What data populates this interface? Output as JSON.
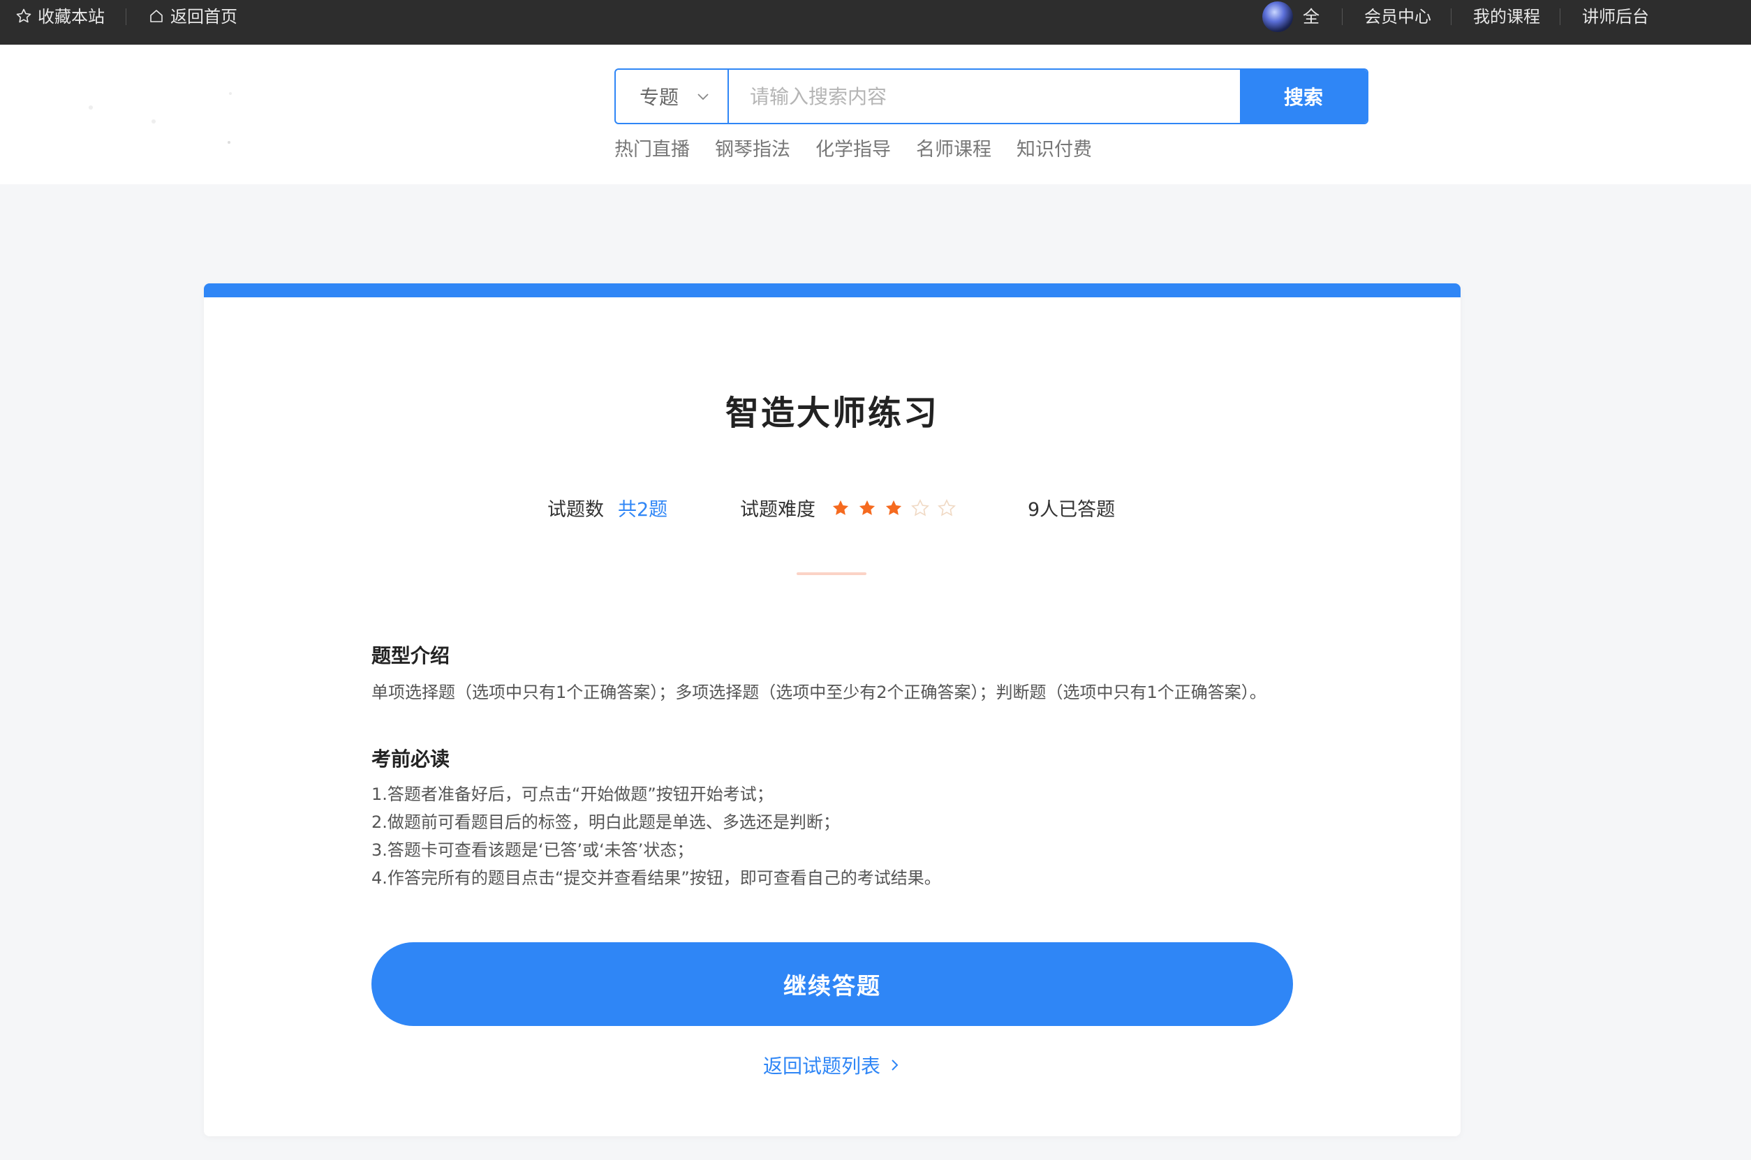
{
  "topbar": {
    "favorite_label": "收藏本站",
    "home_label": "返回首页",
    "username": "全",
    "links": [
      "会员中心",
      "我的课程",
      "讲师后台"
    ]
  },
  "search": {
    "category": "专题",
    "placeholder": "请输入搜索内容",
    "button_label": "搜索"
  },
  "hot_links": [
    "热门直播",
    "钢琴指法",
    "化学指导",
    "名师课程",
    "知识付费"
  ],
  "exam": {
    "title": "智造大师练习",
    "question_count_label": "试题数",
    "question_count_value": "共2题",
    "difficulty_label": "试题难度",
    "difficulty_stars_filled": 3,
    "difficulty_stars_total": 5,
    "answered_text": "9人已答题"
  },
  "intro": {
    "title": "题型介绍",
    "text": "单项选择题（选项中只有1个正确答案）；多项选择题（选项中至少有2个正确答案）；判断题（选项中只有1个正确答案）。"
  },
  "notice": {
    "title": "考前必读",
    "items": [
      "1.答题者准备好后，可点击“开始做题”按钮开始考试；",
      "2.做题前可看题目后的标签，明白此题是单选、多选还是判断；",
      "3.答题卡可查看该题是‘已答’或‘未答’状态；",
      "4.作答完所有的题目点击“提交并查看结果”按钮，即可查看自己的考试结果。"
    ]
  },
  "actions": {
    "continue_label": "继续答题",
    "back_label": "返回试题列表"
  },
  "colors": {
    "primary": "#2f86f6",
    "star": "#f56a1f",
    "topbar_bg": "#2d2d2d"
  }
}
